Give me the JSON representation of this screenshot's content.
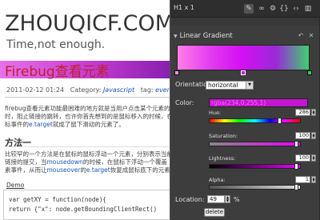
{
  "blog": {
    "site_title": "ZHOUQICF.COM",
    "tagline": "Time,not enough.",
    "post_title": "Firebug查看元素",
    "meta": {
      "date": "2011-02-12 01:24",
      "category_label": "Category:",
      "category": "Javascript",
      "tag_label": "tag:",
      "tag": "event capture"
    },
    "paragraph1": [
      {
        "text": "firebug查看元素功能最困难的地方就是当用户点击某个元素的时候，",
        "link": ""
      },
      {
        "text": "时，阻止链接的跳转，也许你首先想到的是鼠标移入的时候，在鼠",
        "link": ""
      },
      {
        "text": "标事件的",
        "link": "e.target",
        "after": "就成了鼠下滑动的元素了。"
      }
    ],
    "section_heading": "方法一",
    "paragraph2": [
      {
        "text": "比较罕的一个方法是在鼠标的鼠标浮动一个元素，分别表示当前",
        "link": ""
      },
      {
        "text": "链接的提交，当",
        "link": "mousedown",
        "after": "的时候，在鼠标下浮动一个覆盖"
      },
      {
        "text": "素事件，从而让",
        "link": "mouseover",
        "after": "的",
        "link2": "e.target",
        "after2": "恢复成鼠标底下的元素"
      }
    ],
    "demo_label": "Demo",
    "code": [
      "var getXY = function(node){",
      "    return {\"x\": node.getBoundingClientRect()"
    ]
  },
  "panel": {
    "element_label": "H1 x 1",
    "toolbar_icons": [
      "brush-icon",
      "link-icon",
      "gear-icon",
      "braces-icon",
      "code-icon",
      "trash-icon"
    ],
    "section_title": "Linear Gradient",
    "gradient_stops": [
      {
        "color": "#ff8fe6",
        "position": 0
      },
      {
        "color": "#d40ff4",
        "position": 49
      },
      {
        "color": "#35c860",
        "position": 100
      }
    ],
    "orientation_label": "Orientation:",
    "orientation_value": "horizontal",
    "color_label": "Color:",
    "color_value": "rgba(234,0,255,1)",
    "hue_label": "Hue:",
    "hue_value": "286",
    "saturation_label": "Saturation:",
    "saturation_value": "100",
    "lightness_label": "Lightness:",
    "lightness_value": "100",
    "alpha_label": "Alpha:",
    "alpha_value": "1",
    "location_label": "Location:",
    "location_value": "49",
    "location_unit": "%",
    "delete_label": "delete"
  },
  "slider_levels": {
    "hue": 0.79,
    "saturation": 0.98,
    "lightness": 0.98,
    "alpha": 0.98
  }
}
